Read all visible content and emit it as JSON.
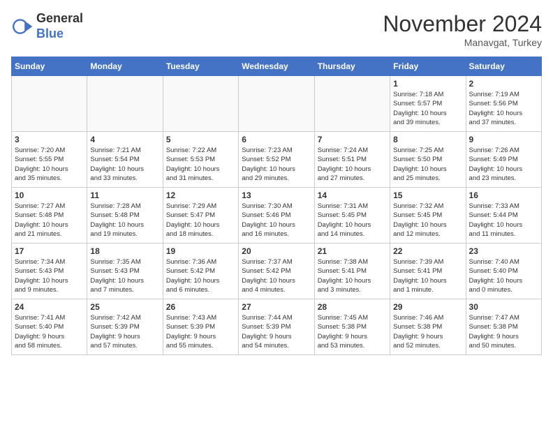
{
  "header": {
    "logo_line1": "General",
    "logo_line2": "Blue",
    "month": "November 2024",
    "location": "Manavgat, Turkey"
  },
  "weekdays": [
    "Sunday",
    "Monday",
    "Tuesday",
    "Wednesday",
    "Thursday",
    "Friday",
    "Saturday"
  ],
  "weeks": [
    [
      {
        "day": "",
        "info": ""
      },
      {
        "day": "",
        "info": ""
      },
      {
        "day": "",
        "info": ""
      },
      {
        "day": "",
        "info": ""
      },
      {
        "day": "",
        "info": ""
      },
      {
        "day": "1",
        "info": "Sunrise: 7:18 AM\nSunset: 5:57 PM\nDaylight: 10 hours\nand 39 minutes."
      },
      {
        "day": "2",
        "info": "Sunrise: 7:19 AM\nSunset: 5:56 PM\nDaylight: 10 hours\nand 37 minutes."
      }
    ],
    [
      {
        "day": "3",
        "info": "Sunrise: 7:20 AM\nSunset: 5:55 PM\nDaylight: 10 hours\nand 35 minutes."
      },
      {
        "day": "4",
        "info": "Sunrise: 7:21 AM\nSunset: 5:54 PM\nDaylight: 10 hours\nand 33 minutes."
      },
      {
        "day": "5",
        "info": "Sunrise: 7:22 AM\nSunset: 5:53 PM\nDaylight: 10 hours\nand 31 minutes."
      },
      {
        "day": "6",
        "info": "Sunrise: 7:23 AM\nSunset: 5:52 PM\nDaylight: 10 hours\nand 29 minutes."
      },
      {
        "day": "7",
        "info": "Sunrise: 7:24 AM\nSunset: 5:51 PM\nDaylight: 10 hours\nand 27 minutes."
      },
      {
        "day": "8",
        "info": "Sunrise: 7:25 AM\nSunset: 5:50 PM\nDaylight: 10 hours\nand 25 minutes."
      },
      {
        "day": "9",
        "info": "Sunrise: 7:26 AM\nSunset: 5:49 PM\nDaylight: 10 hours\nand 23 minutes."
      }
    ],
    [
      {
        "day": "10",
        "info": "Sunrise: 7:27 AM\nSunset: 5:48 PM\nDaylight: 10 hours\nand 21 minutes."
      },
      {
        "day": "11",
        "info": "Sunrise: 7:28 AM\nSunset: 5:48 PM\nDaylight: 10 hours\nand 19 minutes."
      },
      {
        "day": "12",
        "info": "Sunrise: 7:29 AM\nSunset: 5:47 PM\nDaylight: 10 hours\nand 18 minutes."
      },
      {
        "day": "13",
        "info": "Sunrise: 7:30 AM\nSunset: 5:46 PM\nDaylight: 10 hours\nand 16 minutes."
      },
      {
        "day": "14",
        "info": "Sunrise: 7:31 AM\nSunset: 5:45 PM\nDaylight: 10 hours\nand 14 minutes."
      },
      {
        "day": "15",
        "info": "Sunrise: 7:32 AM\nSunset: 5:45 PM\nDaylight: 10 hours\nand 12 minutes."
      },
      {
        "day": "16",
        "info": "Sunrise: 7:33 AM\nSunset: 5:44 PM\nDaylight: 10 hours\nand 11 minutes."
      }
    ],
    [
      {
        "day": "17",
        "info": "Sunrise: 7:34 AM\nSunset: 5:43 PM\nDaylight: 10 hours\nand 9 minutes."
      },
      {
        "day": "18",
        "info": "Sunrise: 7:35 AM\nSunset: 5:43 PM\nDaylight: 10 hours\nand 7 minutes."
      },
      {
        "day": "19",
        "info": "Sunrise: 7:36 AM\nSunset: 5:42 PM\nDaylight: 10 hours\nand 6 minutes."
      },
      {
        "day": "20",
        "info": "Sunrise: 7:37 AM\nSunset: 5:42 PM\nDaylight: 10 hours\nand 4 minutes."
      },
      {
        "day": "21",
        "info": "Sunrise: 7:38 AM\nSunset: 5:41 PM\nDaylight: 10 hours\nand 3 minutes."
      },
      {
        "day": "22",
        "info": "Sunrise: 7:39 AM\nSunset: 5:41 PM\nDaylight: 10 hours\nand 1 minute."
      },
      {
        "day": "23",
        "info": "Sunrise: 7:40 AM\nSunset: 5:40 PM\nDaylight: 10 hours\nand 0 minutes."
      }
    ],
    [
      {
        "day": "24",
        "info": "Sunrise: 7:41 AM\nSunset: 5:40 PM\nDaylight: 9 hours\nand 58 minutes."
      },
      {
        "day": "25",
        "info": "Sunrise: 7:42 AM\nSunset: 5:39 PM\nDaylight: 9 hours\nand 57 minutes."
      },
      {
        "day": "26",
        "info": "Sunrise: 7:43 AM\nSunset: 5:39 PM\nDaylight: 9 hours\nand 55 minutes."
      },
      {
        "day": "27",
        "info": "Sunrise: 7:44 AM\nSunset: 5:39 PM\nDaylight: 9 hours\nand 54 minutes."
      },
      {
        "day": "28",
        "info": "Sunrise: 7:45 AM\nSunset: 5:38 PM\nDaylight: 9 hours\nand 53 minutes."
      },
      {
        "day": "29",
        "info": "Sunrise: 7:46 AM\nSunset: 5:38 PM\nDaylight: 9 hours\nand 52 minutes."
      },
      {
        "day": "30",
        "info": "Sunrise: 7:47 AM\nSunset: 5:38 PM\nDaylight: 9 hours\nand 50 minutes."
      }
    ]
  ]
}
